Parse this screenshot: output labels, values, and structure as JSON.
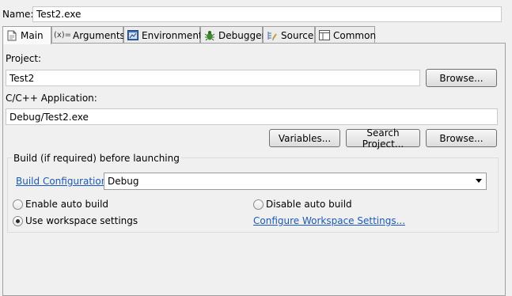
{
  "name": {
    "label": "Name:",
    "value": "Test2.exe"
  },
  "tabs": [
    {
      "label": "Main",
      "icon": "document-icon"
    },
    {
      "label": "Arguments",
      "icon": "variable-icon"
    },
    {
      "label": "Environment",
      "icon": "environment-icon"
    },
    {
      "label": "Debugger",
      "icon": "bug-icon"
    },
    {
      "label": "Source",
      "icon": "source-icon"
    },
    {
      "label": "Common",
      "icon": "common-icon"
    }
  ],
  "main": {
    "project": {
      "label": "Project:",
      "value": "Test2",
      "browse": "Browse..."
    },
    "application": {
      "label": "C/C++ Application:",
      "value": "Debug/Test2.exe"
    },
    "buttons": {
      "variables": "Variables...",
      "search_project": "Search Project...",
      "browse": "Browse..."
    },
    "build": {
      "group_title": "Build (if required) before launching",
      "config_link": "Build Configuration:",
      "config_value": "Debug",
      "enable_auto": "Enable auto build",
      "disable_auto": "Disable auto build",
      "use_workspace": "Use workspace settings",
      "configure_link": "Configure Workspace Settings...",
      "selected": "use_workspace"
    }
  },
  "colors": {
    "link": "#1a5ab6",
    "panel": "#f0f0f0"
  }
}
